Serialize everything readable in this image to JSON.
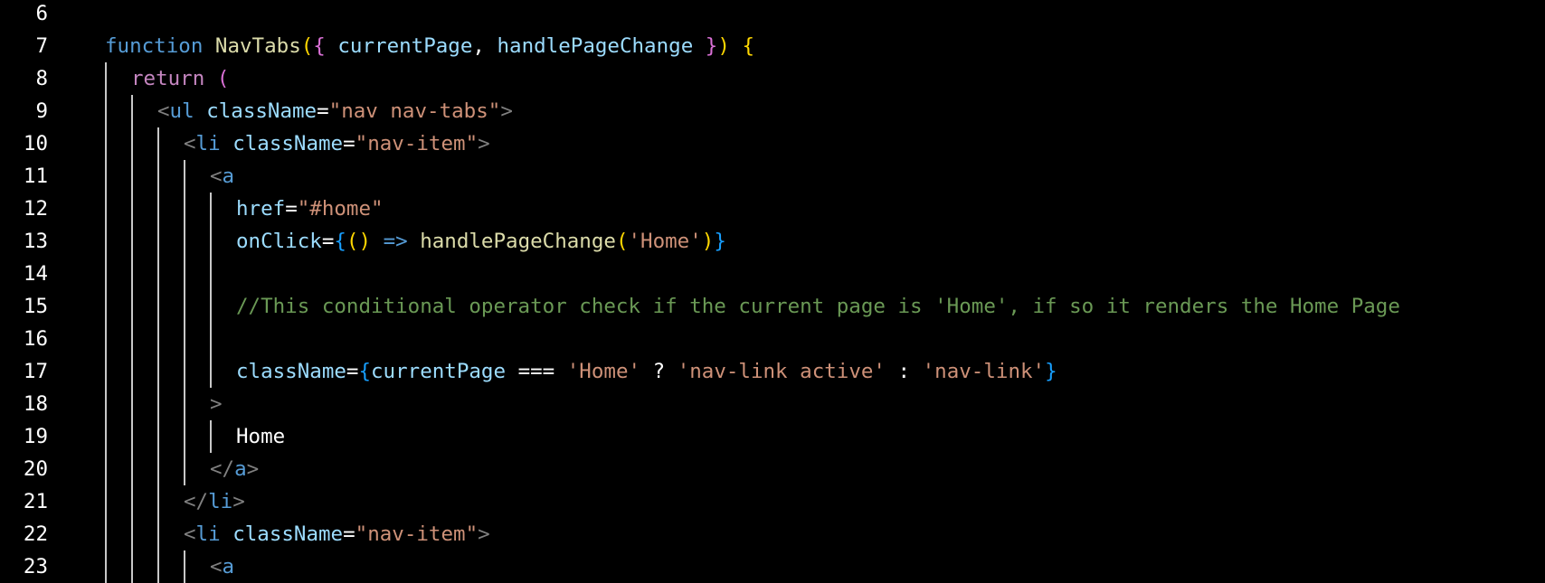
{
  "editor": {
    "colors": {
      "background": "#000000",
      "line_number": "#ffffff",
      "keyword_blue": "#569cd6",
      "keyword_purple": "#c586c0",
      "function_yellow": "#dcdcaa",
      "variable_lightblue": "#9cdcfe",
      "string_orange": "#ce9178",
      "comment_green": "#6a9955",
      "tag_gray": "#808080",
      "bracket_gold": "#ffd700",
      "bracket_pink": "#da70d6",
      "bracket_blue": "#179fff",
      "text_white": "#ffffff"
    },
    "lines": [
      {
        "number": "6",
        "indent": 0,
        "tokens": []
      },
      {
        "number": "7",
        "indent": 0,
        "tokens": [
          {
            "text": "function ",
            "color": "#569cd6"
          },
          {
            "text": "NavTabs",
            "color": "#dcdcaa"
          },
          {
            "text": "(",
            "color": "#ffd700"
          },
          {
            "text": "{",
            "color": "#da70d6"
          },
          {
            "text": " ",
            "color": "#ffffff"
          },
          {
            "text": "currentPage",
            "color": "#9cdcfe"
          },
          {
            "text": ", ",
            "color": "#ffffff"
          },
          {
            "text": "handlePageChange",
            "color": "#9cdcfe"
          },
          {
            "text": " ",
            "color": "#ffffff"
          },
          {
            "text": "}",
            "color": "#da70d6"
          },
          {
            "text": ")",
            "color": "#ffd700"
          },
          {
            "text": " ",
            "color": "#ffffff"
          },
          {
            "text": "{",
            "color": "#ffd700"
          }
        ]
      },
      {
        "number": "8",
        "indent": 1,
        "tokens": [
          {
            "text": "return ",
            "color": "#c586c0"
          },
          {
            "text": "(",
            "color": "#da70d6"
          }
        ]
      },
      {
        "number": "9",
        "indent": 2,
        "tokens": [
          {
            "text": "<",
            "color": "#808080"
          },
          {
            "text": "ul",
            "color": "#569cd6"
          },
          {
            "text": " ",
            "color": "#ffffff"
          },
          {
            "text": "className",
            "color": "#9cdcfe"
          },
          {
            "text": "=",
            "color": "#ffffff"
          },
          {
            "text": "\"nav nav-tabs\"",
            "color": "#ce9178"
          },
          {
            "text": ">",
            "color": "#808080"
          }
        ]
      },
      {
        "number": "10",
        "indent": 3,
        "tokens": [
          {
            "text": "<",
            "color": "#808080"
          },
          {
            "text": "li",
            "color": "#569cd6"
          },
          {
            "text": " ",
            "color": "#ffffff"
          },
          {
            "text": "className",
            "color": "#9cdcfe"
          },
          {
            "text": "=",
            "color": "#ffffff"
          },
          {
            "text": "\"nav-item\"",
            "color": "#ce9178"
          },
          {
            "text": ">",
            "color": "#808080"
          }
        ]
      },
      {
        "number": "11",
        "indent": 4,
        "tokens": [
          {
            "text": "<",
            "color": "#808080"
          },
          {
            "text": "a",
            "color": "#569cd6"
          }
        ]
      },
      {
        "number": "12",
        "indent": 5,
        "tokens": [
          {
            "text": "href",
            "color": "#9cdcfe"
          },
          {
            "text": "=",
            "color": "#ffffff"
          },
          {
            "text": "\"#home\"",
            "color": "#ce9178"
          }
        ]
      },
      {
        "number": "13",
        "indent": 5,
        "tokens": [
          {
            "text": "onClick",
            "color": "#9cdcfe"
          },
          {
            "text": "=",
            "color": "#ffffff"
          },
          {
            "text": "{",
            "color": "#179fff"
          },
          {
            "text": "()",
            "color": "#ffd700"
          },
          {
            "text": " ",
            "color": "#ffffff"
          },
          {
            "text": "=>",
            "color": "#569cd6"
          },
          {
            "text": " ",
            "color": "#ffffff"
          },
          {
            "text": "handlePageChange",
            "color": "#dcdcaa"
          },
          {
            "text": "(",
            "color": "#ffd700"
          },
          {
            "text": "'Home'",
            "color": "#ce9178"
          },
          {
            "text": ")",
            "color": "#ffd700"
          },
          {
            "text": "}",
            "color": "#179fff"
          }
        ]
      },
      {
        "number": "14",
        "indent": 5,
        "tokens": []
      },
      {
        "number": "15",
        "indent": 5,
        "tokens": [
          {
            "text": "//This conditional operator check if the current page is 'Home', if so it renders the Home Page",
            "color": "#6a9955"
          }
        ]
      },
      {
        "number": "16",
        "indent": 5,
        "tokens": []
      },
      {
        "number": "17",
        "indent": 5,
        "tokens": [
          {
            "text": "className",
            "color": "#9cdcfe"
          },
          {
            "text": "=",
            "color": "#ffffff"
          },
          {
            "text": "{",
            "color": "#179fff"
          },
          {
            "text": "currentPage",
            "color": "#9cdcfe"
          },
          {
            "text": " === ",
            "color": "#ffffff"
          },
          {
            "text": "'Home'",
            "color": "#ce9178"
          },
          {
            "text": " ? ",
            "color": "#ffffff"
          },
          {
            "text": "'nav-link active'",
            "color": "#ce9178"
          },
          {
            "text": " : ",
            "color": "#ffffff"
          },
          {
            "text": "'nav-link'",
            "color": "#ce9178"
          },
          {
            "text": "}",
            "color": "#179fff"
          }
        ]
      },
      {
        "number": "18",
        "indent": 4,
        "tokens": [
          {
            "text": ">",
            "color": "#808080"
          }
        ]
      },
      {
        "number": "19",
        "indent": 5,
        "tokens": [
          {
            "text": "Home",
            "color": "#ffffff"
          }
        ]
      },
      {
        "number": "20",
        "indent": 4,
        "tokens": [
          {
            "text": "</",
            "color": "#808080"
          },
          {
            "text": "a",
            "color": "#569cd6"
          },
          {
            "text": ">",
            "color": "#808080"
          }
        ]
      },
      {
        "number": "21",
        "indent": 3,
        "tokens": [
          {
            "text": "</",
            "color": "#808080"
          },
          {
            "text": "li",
            "color": "#569cd6"
          },
          {
            "text": ">",
            "color": "#808080"
          }
        ]
      },
      {
        "number": "22",
        "indent": 3,
        "tokens": [
          {
            "text": "<",
            "color": "#808080"
          },
          {
            "text": "li",
            "color": "#569cd6"
          },
          {
            "text": " ",
            "color": "#ffffff"
          },
          {
            "text": "className",
            "color": "#9cdcfe"
          },
          {
            "text": "=",
            "color": "#ffffff"
          },
          {
            "text": "\"nav-item\"",
            "color": "#ce9178"
          },
          {
            "text": ">",
            "color": "#808080"
          }
        ]
      },
      {
        "number": "23",
        "indent": 4,
        "tokens": [
          {
            "text": "<",
            "color": "#808080"
          },
          {
            "text": "a",
            "color": "#569cd6"
          }
        ]
      }
    ]
  }
}
